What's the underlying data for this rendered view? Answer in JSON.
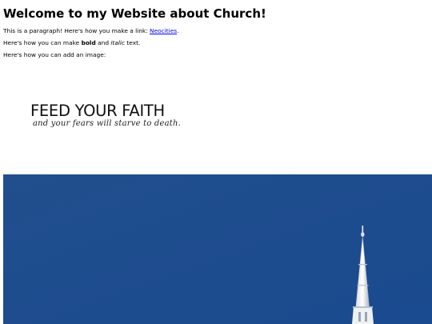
{
  "heading": "Welcome to my Website about Church!",
  "paragraph1": {
    "text": "This is a paragraph! Here's how you make a link: ",
    "link_text": "Neocities",
    "suffix": "."
  },
  "paragraph2": {
    "prefix": "Here's how you can make ",
    "bold": "bold",
    "middle": " and ",
    "italic": "italic",
    "suffix": " text."
  },
  "paragraph3": "Here's how you can add an image:",
  "image1": {
    "title": "FEED YOUR FAITH",
    "subtitle": "and your fears will starve to death."
  },
  "image2": {
    "subject": "church steeple against blue sky"
  },
  "colors": {
    "link": "#0000ee",
    "sky": "#1d4c8f"
  }
}
